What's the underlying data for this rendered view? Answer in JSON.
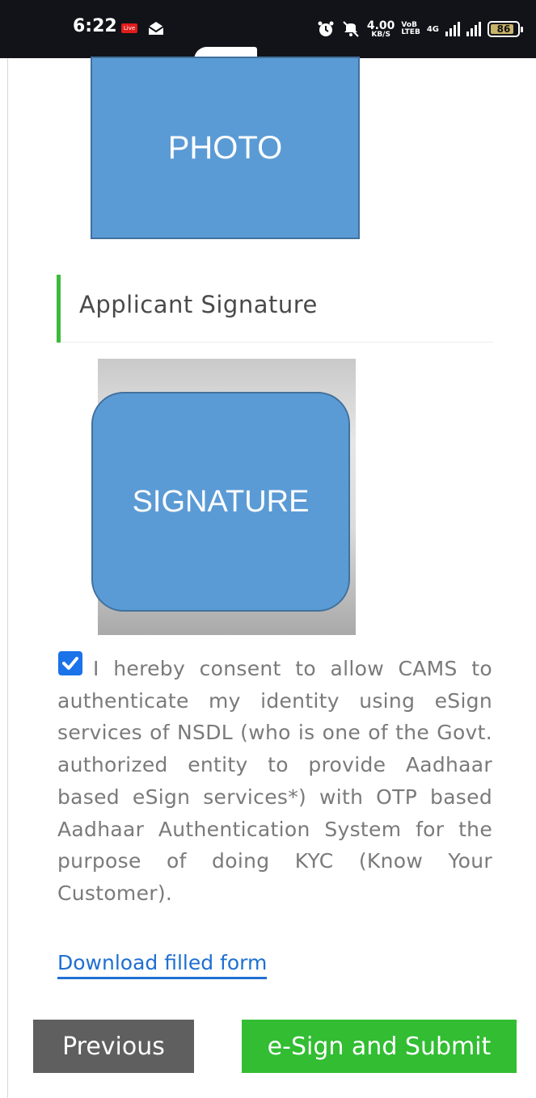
{
  "status_bar": {
    "time": "6:22",
    "live_badge": "Live",
    "speed_value": "4.00",
    "speed_unit": "KB/S",
    "volte_top": "VoB",
    "volte_bottom": "LTEB",
    "network": "4G",
    "battery": "86"
  },
  "photo": {
    "label": "PHOTO"
  },
  "signature_section": {
    "title": "Applicant Signature",
    "placeholder": "SIGNATURE"
  },
  "consent": {
    "checked": true,
    "text": "I hereby consent to allow CAMS to authenticate my identity using eSign services of NSDL (who is one of the Govt. authorized entity to provide Aadhaar based eSign services*) with OTP based Aadhaar Authentication System for the purpose of doing KYC (Know Your Customer)."
  },
  "links": {
    "download": "Download filled form"
  },
  "buttons": {
    "previous": "Previous",
    "submit": "e-Sign and Submit"
  },
  "colors": {
    "accent_green": "#32bd32",
    "section_bar": "#3dba3d",
    "link_blue": "#1f6fd1",
    "placeholder_fill": "#5b9bd5",
    "previous_button": "#5f5f5f"
  }
}
